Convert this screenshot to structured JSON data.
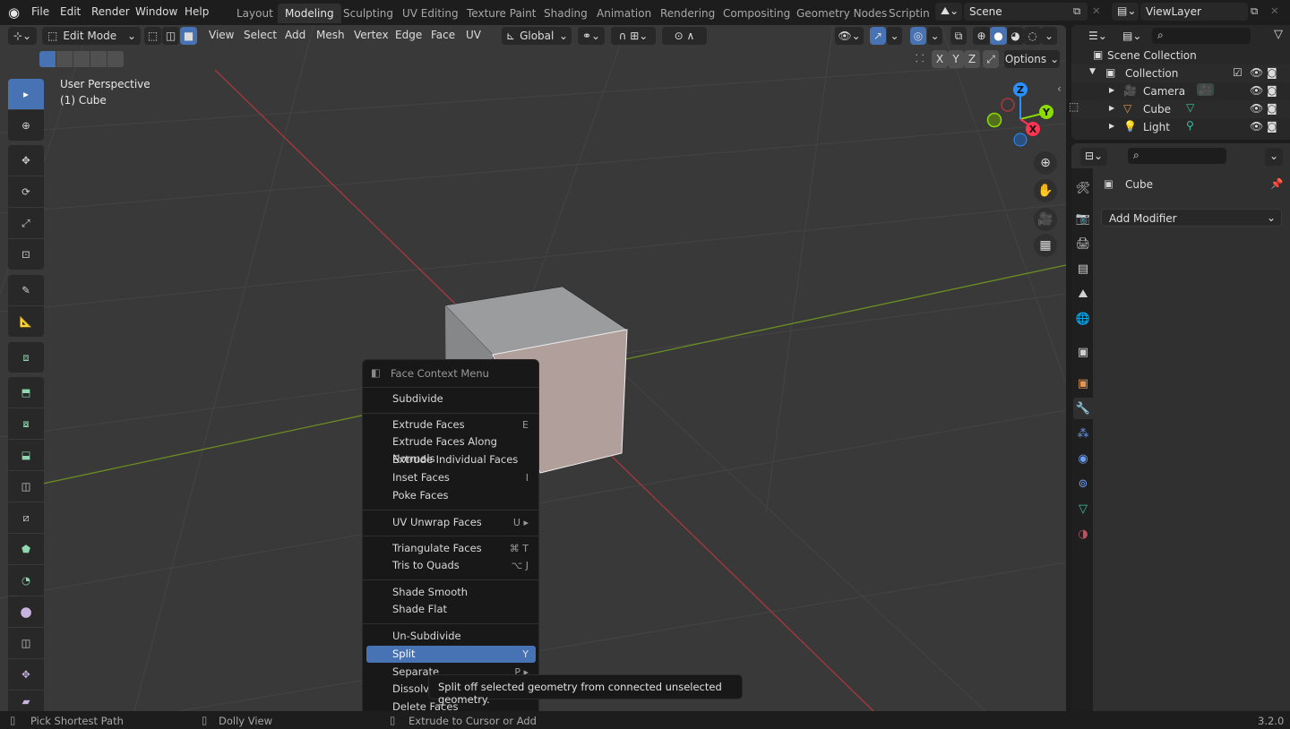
{
  "topbar": {
    "menus": [
      "File",
      "Edit",
      "Render",
      "Window",
      "Help"
    ],
    "workspaces": [
      "Layout",
      "Modeling",
      "Sculpting",
      "UV Editing",
      "Texture Paint",
      "Shading",
      "Animation",
      "Rendering",
      "Compositing",
      "Geometry Nodes",
      "Scripting"
    ],
    "active_workspace": "Modeling",
    "scene": "Scene",
    "view_layer": "ViewLayer"
  },
  "viewport_header": {
    "mode": "Edit Mode",
    "menus": [
      "View",
      "Select",
      "Add",
      "Mesh",
      "Vertex",
      "Edge",
      "Face",
      "UV"
    ],
    "transform_orientation": "Global",
    "axis_buttons": [
      "X",
      "Y",
      "Z"
    ],
    "options_label": "Options",
    "select_mode_active": "face"
  },
  "viewport": {
    "view_name": "User Perspective",
    "object_info": "(1) Cube",
    "gizmo_axes": [
      "Z",
      "Y",
      "X"
    ]
  },
  "toolbar": {
    "tools": [
      "select-box",
      "cursor",
      "move",
      "rotate",
      "scale",
      "transform",
      "annotate",
      "measure",
      "add-cube",
      "extrude-region",
      "inset-faces",
      "bevel",
      "loop-cut",
      "knife",
      "poly-build",
      "spin",
      "smooth",
      "edge-slide",
      "shrink-fatten",
      "shear"
    ],
    "active_tool": "select-box"
  },
  "context_menu": {
    "title": "Face Context Menu",
    "groups": [
      [
        {
          "label": "Subdivide",
          "shortcut": ""
        }
      ],
      [
        {
          "label": "Extrude Faces",
          "shortcut": "E"
        },
        {
          "label": "Extrude Faces Along Normals",
          "shortcut": ""
        },
        {
          "label": "Extrude Individual Faces",
          "shortcut": ""
        },
        {
          "label": "Inset Faces",
          "shortcut": "I"
        },
        {
          "label": "Poke Faces",
          "shortcut": ""
        }
      ],
      [
        {
          "label": "UV Unwrap Faces",
          "shortcut": "U ▸"
        }
      ],
      [
        {
          "label": "Triangulate Faces",
          "shortcut": "⌘ T"
        },
        {
          "label": "Tris to Quads",
          "shortcut": "⌥ J"
        }
      ],
      [
        {
          "label": "Shade Smooth",
          "shortcut": ""
        },
        {
          "label": "Shade Flat",
          "shortcut": ""
        }
      ],
      [
        {
          "label": "Un-Subdivide",
          "shortcut": ""
        },
        {
          "label": "Split",
          "shortcut": "Y"
        },
        {
          "label": "Separate",
          "shortcut": "P ▸"
        },
        {
          "label": "Dissolve Faces",
          "shortcut": ""
        },
        {
          "label": "Delete Faces",
          "shortcut": ""
        }
      ]
    ],
    "highlighted": "Split",
    "tooltip": "Split off selected geometry from connected unselected geometry."
  },
  "outliner": {
    "root": "Scene Collection",
    "collection": "Collection",
    "items": [
      {
        "name": "Camera",
        "icon": "camera-icon",
        "color": "#e19658"
      },
      {
        "name": "Cube",
        "icon": "mesh-icon",
        "color": "#e19658"
      },
      {
        "name": "Light",
        "icon": "light-icon",
        "color": "#e19658"
      }
    ]
  },
  "properties": {
    "object_name": "Cube",
    "add_modifier_label": "Add Modifier",
    "active_tab": "modifiers"
  },
  "statusbar": {
    "left_hint": "Pick Shortest Path",
    "middle_hint": "Dolly View",
    "right_hint": "Extrude to Cursor or Add",
    "version": "3.2.0"
  },
  "colors": {
    "accent": "#4772b3",
    "axis_x": "#ff3352",
    "axis_y": "#8bdc00",
    "axis_z": "#2890ff"
  }
}
